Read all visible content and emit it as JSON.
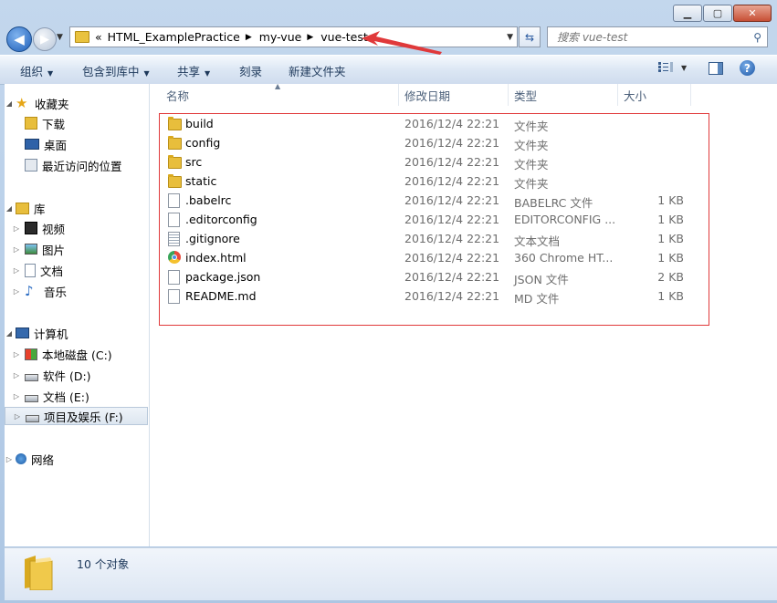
{
  "window": {
    "buttons": {
      "minimize": "▁",
      "maximize": "▢",
      "close": "✕"
    }
  },
  "nav": {
    "back_icon": "arrow-left-icon",
    "forward_icon": "arrow-right-icon",
    "overflow": "«",
    "breadcrumbs": [
      "HTML_ExamplePractice",
      "my-vue",
      "vue-test"
    ],
    "search_placeholder": "搜索 vue-test"
  },
  "toolbar": {
    "organize": "组织",
    "include_library": "包含到库中",
    "share": "共享",
    "burn": "刻录",
    "new_folder": "新建文件夹",
    "help": "?"
  },
  "sidebar": {
    "favorites": {
      "label": "收藏夹",
      "items": [
        "下载",
        "桌面",
        "最近访问的位置"
      ]
    },
    "libraries": {
      "label": "库",
      "items": [
        "视频",
        "图片",
        "文档",
        "音乐"
      ]
    },
    "computer": {
      "label": "计算机",
      "items": [
        "本地磁盘 (C:)",
        "软件 (D:)",
        "文档 (E:)",
        "项目及娱乐 (F:)"
      ]
    },
    "network": {
      "label": "网络"
    }
  },
  "columns": {
    "name": "名称",
    "date": "修改日期",
    "type": "类型",
    "size": "大小"
  },
  "files": [
    {
      "name": "build",
      "date": "2016/12/4 22:21",
      "type": "文件夹",
      "size": "",
      "icon": "folder"
    },
    {
      "name": "config",
      "date": "2016/12/4 22:21",
      "type": "文件夹",
      "size": "",
      "icon": "folder"
    },
    {
      "name": "src",
      "date": "2016/12/4 22:21",
      "type": "文件夹",
      "size": "",
      "icon": "folder"
    },
    {
      "name": "static",
      "date": "2016/12/4 22:21",
      "type": "文件夹",
      "size": "",
      "icon": "folder"
    },
    {
      "name": ".babelrc",
      "date": "2016/12/4 22:21",
      "type": "BABELRC 文件",
      "size": "1 KB",
      "icon": "doc"
    },
    {
      "name": ".editorconfig",
      "date": "2016/12/4 22:21",
      "type": "EDITORCONFIG ...",
      "size": "1 KB",
      "icon": "doc"
    },
    {
      "name": ".gitignore",
      "date": "2016/12/4 22:21",
      "type": "文本文档",
      "size": "1 KB",
      "icon": "txt"
    },
    {
      "name": "index.html",
      "date": "2016/12/4 22:21",
      "type": "360 Chrome HT...",
      "size": "1 KB",
      "icon": "chrome"
    },
    {
      "name": "package.json",
      "date": "2016/12/4 22:21",
      "type": "JSON 文件",
      "size": "2 KB",
      "icon": "doc"
    },
    {
      "name": "README.md",
      "date": "2016/12/4 22:21",
      "type": "MD 文件",
      "size": "1 KB",
      "icon": "doc"
    }
  ],
  "status": {
    "count": "10 个对象"
  },
  "colors": {
    "annotation_red": "#e0393a",
    "folder_yellow": "#e8be3c",
    "link_blue": "#1e395b"
  }
}
